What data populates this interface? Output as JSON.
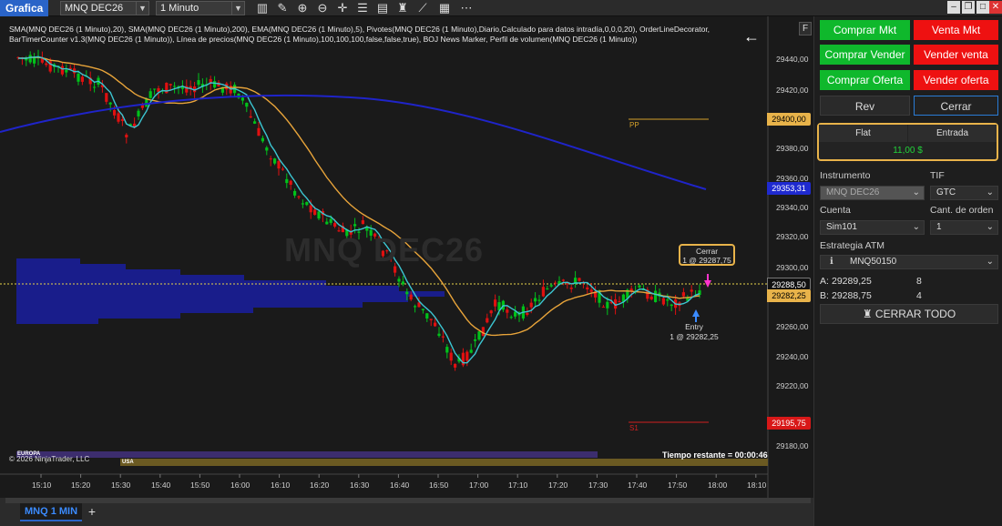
{
  "app_title": "Grafica",
  "toolbar": {
    "instrument": "MNQ DEC26",
    "interval": "1 Minuto",
    "icons": [
      "bar-type-icon",
      "draw-pencil-icon",
      "zoom-in-icon",
      "zoom-out-icon",
      "crosshair-icon",
      "properties-icon",
      "indicators-icon",
      "strategies-icon",
      "chart-trader-icon",
      "data-box-icon",
      "more-icon"
    ]
  },
  "window_controls": [
    "minimize",
    "restore",
    "maximize",
    "close"
  ],
  "chart": {
    "indicator_text": "SMA(MNQ DEC26 (1 Minuto),20), SMA(MNQ DEC26 (1 Minuto),200), EMA(MNQ DEC26 (1 Minuto),5), Pivotes(MNQ DEC26 (1 Minuto),Diario,Calculado para datos intradía,0,0,0,20), OrderLineDecorator, BarTimerCounter v1.3(MNQ DEC26 (1 Minuto)), Línea de precios(MNQ DEC26 (1 Minuto),100,100,100,false,false,true), BOJ News Marker, Perfil de volumen(MNQ DEC26 (1 Minuto))",
    "watermark": "MNQ DEC26",
    "f_button": "F",
    "copyright": "© 2026 NinjaTrader, LLC",
    "time_remaining": "Tiempo restante = 00:00:46",
    "session_europa": "EUROPA",
    "session_usa": "USA",
    "pivot_pp": "PP",
    "pivot_s1": "S1",
    "close_label": "Cerrar",
    "close_qty": "1 @ 29287,75",
    "entry_label": "Entry",
    "entry_qty": "1 @ 29282,25",
    "price_ticks": [
      "29440,00",
      "29420,00",
      "29380,00",
      "29360,00",
      "29340,00",
      "29320,00",
      "29300,00",
      "29260,00",
      "29240,00",
      "29220,00",
      "29180,00"
    ],
    "price_tags": {
      "pp": "29400,00",
      "sma200": "29353,31",
      "last": "29288,50",
      "entry": "29282,25",
      "s1": "29195,75"
    },
    "time_ticks": [
      "15:10",
      "15:20",
      "15:30",
      "15:40",
      "15:50",
      "16:00",
      "16:10",
      "16:20",
      "16:30",
      "16:40",
      "16:50",
      "17:00",
      "17:10",
      "17:20",
      "17:30",
      "17:40",
      "17:50",
      "18:00",
      "18:10"
    ]
  },
  "tabs": [
    {
      "label": "MNQ 1 MIN"
    }
  ],
  "add_tab": "+",
  "panel": {
    "buy_market": "Comprar Mkt",
    "sell_market": "Venta Mkt",
    "buy_bid": "Comprar Vender",
    "sell_ask": "Vender venta",
    "buy_ask": "Comprar Oferta",
    "sell_bid": "Vender oferta",
    "rev": "Rev",
    "close": "Cerrar",
    "position_state": "Flat",
    "position_entry": "Entrada",
    "position_pnl": "11,00 $",
    "instrument_label": "Instrumento",
    "instrument_value": "MNQ DEC26",
    "tif_label": "TIF",
    "tif_value": "GTC",
    "account_label": "Cuenta",
    "account_value": "Sim101",
    "qty_label": "Cant. de orden",
    "qty_value": "1",
    "atm_label": "Estrategia ATM",
    "atm_value": "MNQ50150",
    "ask_label": "A:",
    "ask_price": "29289,25",
    "ask_size": "8",
    "bid_label": "B:",
    "bid_price": "29288,75",
    "bid_size": "4",
    "close_all": "CERRAR TODO"
  },
  "colors": {
    "up_candle": "#00c21a",
    "down_candle": "#e01010",
    "ema": "#3cc6d2",
    "sma20": "#e8a43a",
    "sma200": "#1f24c9",
    "pivot_pp": "#d4a02a",
    "pivot_s1": "#d02020",
    "volume_profile": "#1a1fa0"
  }
}
